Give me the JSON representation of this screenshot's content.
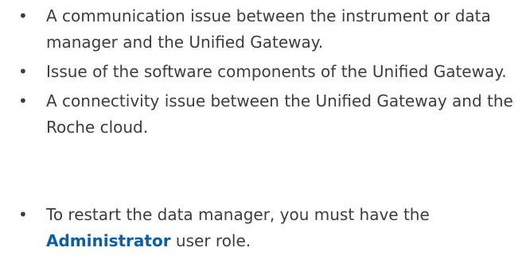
{
  "causes": [
    "A communication issue between the instrument or data manager and the Unified Gateway.",
    "Issue of the software components of the Unified Gateway.",
    "A connectivity issue between the Unified Gateway and the Roche cloud."
  ],
  "note": {
    "before": "To restart the data manager, you must have the ",
    "role": "Administrator",
    "after": " user role."
  },
  "bullet_glyph": "•",
  "colors": {
    "text": "#3d3d3d",
    "role_highlight": "#0b5fa5"
  }
}
